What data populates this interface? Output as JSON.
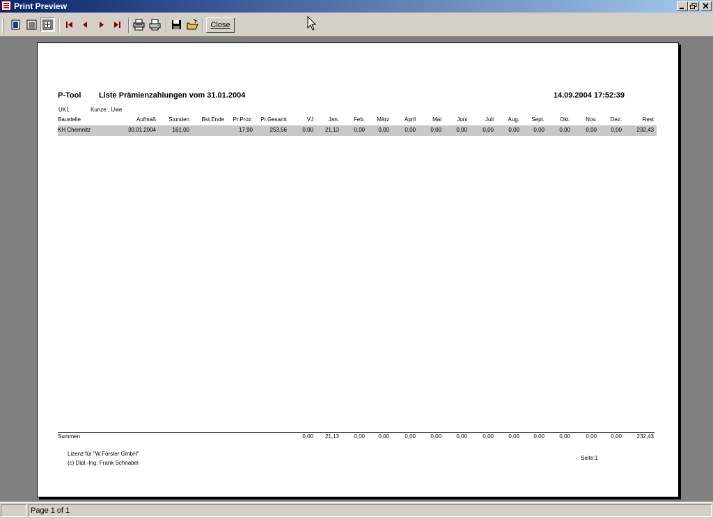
{
  "window": {
    "title": "Print Preview"
  },
  "toolbar": {
    "close_label": "Close"
  },
  "report": {
    "app": "P-Tool",
    "title": "Liste Prämienzahlungen vom 31.01.2004",
    "datetime": "14.09.2004 17:52:39",
    "uk_code": "UK1",
    "employee": "Kunze , Uwe",
    "columns": [
      "Baustelle",
      "Aufmaß",
      "Stunden",
      "Bst.Ende",
      "Pr.Proz.",
      "Pr.Gesamt",
      "VJ",
      "Jan.",
      "Feb.",
      "März",
      "April",
      "Mai",
      "Juni",
      "Juli",
      "Aug.",
      "Sept.",
      "Okt.",
      "Nov.",
      "Dez.",
      "Rest"
    ],
    "row": [
      "KH Chemnitz",
      "30.01.2004",
      "161,00",
      "",
      "17,90",
      "253,56",
      "0,00",
      "21,13",
      "0,00",
      "0,00",
      "0,00",
      "0,00",
      "0,00",
      "0,00",
      "0,00",
      "0,00",
      "0,00",
      "0,00",
      "0,00",
      "232,43"
    ],
    "summen_label": "Summen",
    "summen": [
      "",
      "",
      "",
      "",
      "",
      "",
      "0,00",
      "21,13",
      "0,00",
      "0,00",
      "0,00",
      "0,00",
      "0,00",
      "0,00",
      "0,00",
      "0,00",
      "0,00",
      "0,00",
      "0,00",
      "232,43"
    ],
    "license_line1": "Lizenz für \"W.Förster GmbH\"",
    "license_line2": "(c) Dipl.-Ing. Frank Schnabel",
    "page_label": "Seite:1"
  },
  "status": {
    "page_info": "Page 1 of 1"
  }
}
